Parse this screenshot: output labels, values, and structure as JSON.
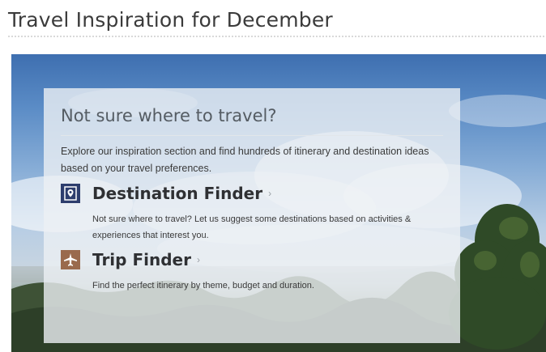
{
  "page": {
    "title": "Travel Inspiration for December"
  },
  "hero": {
    "image": "sky-clouds-forest-photo"
  },
  "panel": {
    "heading": "Not sure where to travel?",
    "intro": "Explore our inspiration section and find hundreds of itinerary and destination ideas based on your travel preferences.",
    "finders": [
      {
        "icon": "map-pin-icon",
        "title": "Destination Finder",
        "arrow": "›",
        "description": "Not sure where to travel? Let us suggest some destinations based on activities & experiences that interest you."
      },
      {
        "icon": "airplane-icon",
        "title": "Trip Finder",
        "arrow": "›",
        "description": "Find the perfect itinerary by theme, budget and duration."
      }
    ]
  },
  "colors": {
    "destination_icon_bg": "#2d3d6d",
    "trip_icon_bg": "#9a6a4d",
    "title_text": "#3b3b3b"
  }
}
